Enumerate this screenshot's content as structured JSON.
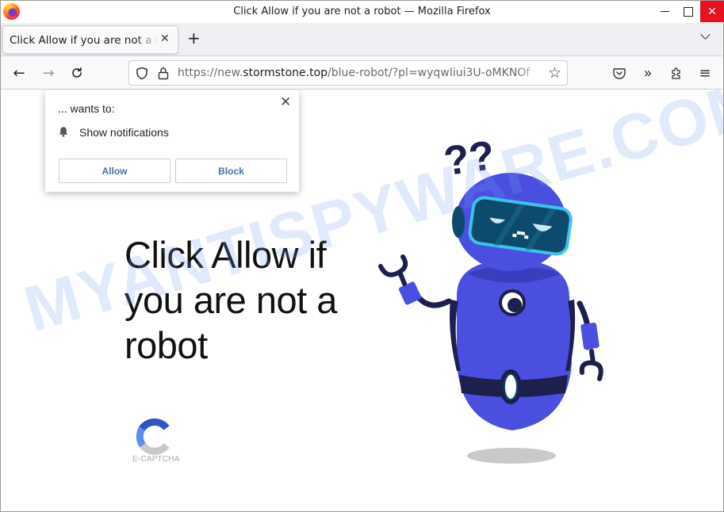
{
  "window": {
    "title": "Click Allow if you are not a robot — Mozilla Firefox",
    "controls": {
      "minimize": "minimize",
      "maximize": "maximize",
      "close": "✕"
    }
  },
  "tabs": [
    {
      "title": "Click Allow if you are not a robot",
      "close": "✕",
      "active": true
    }
  ],
  "tabstrip": {
    "new_tab": "+"
  },
  "navbar": {
    "back": "←",
    "forward": "→",
    "reload": "↻",
    "url": {
      "scheme": "https://new.",
      "domain": "stormstone.top",
      "path": "/blue-robot/?pl=wyqwIiui3U-oMKNOf"
    },
    "bookmark": "☆",
    "overflow": "»",
    "menu": "≡"
  },
  "permission_popup": {
    "wants_to": "... wants to:",
    "permission": "Show notifications",
    "close": "✕",
    "allow_label": "Allow",
    "block_label": "Block"
  },
  "page": {
    "headline": "Click Allow if you are not a robot",
    "captcha_label": "E-CAPTCHA",
    "watermark": "MYANTISPYWARE.COM",
    "question_marks": "??"
  },
  "colors": {
    "robot_body": "#4a4fe0",
    "robot_dark": "#1d1f4d",
    "visor": "#0e4a6b",
    "visor_rim": "#39c4ef",
    "close_button": "#e81123",
    "popup_button_text": "#4a6fa5"
  }
}
